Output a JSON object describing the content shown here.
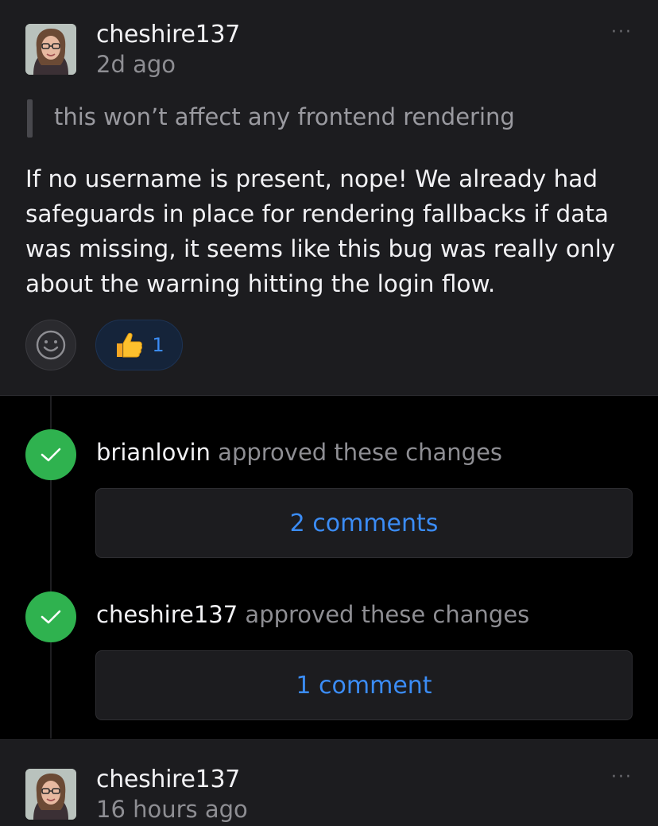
{
  "comment_top": {
    "author": "cheshire137",
    "timestamp": "2d ago",
    "more_label": "···",
    "quote": "this won’t affect any frontend rendering",
    "body": "If no username is present, nope! We already had safeguards in place for rendering fallbacks if data was missing, it seems like this bug was really only about the warning hitting the login flow.",
    "reactions": [
      {
        "emoji": "👍",
        "count": "1"
      }
    ]
  },
  "timeline": [
    {
      "user": "brianlovin",
      "action": "approved these changes",
      "comments_label": "2 comments"
    },
    {
      "user": "cheshire137",
      "action": "approved these changes",
      "comments_label": "1 comment"
    }
  ],
  "comment_bottom": {
    "author": "cheshire137",
    "timestamp": "16 hours ago",
    "more_label": "···"
  },
  "colors": {
    "background": "#000000",
    "card": "#1c1c1f",
    "link_blue": "#3b8cf5",
    "approved_green": "#2fb24f",
    "muted_text": "#8e8e93"
  },
  "icons": [
    "avatar",
    "more-icon",
    "smiley-icon",
    "thumbs-up-emoji",
    "checkmark-icon"
  ]
}
